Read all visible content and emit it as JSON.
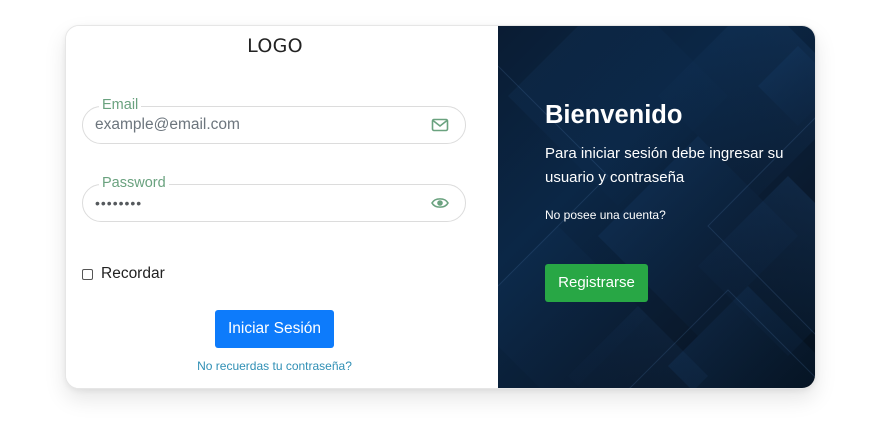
{
  "logo": {
    "text": "LOGO"
  },
  "login_form": {
    "email": {
      "label": "Email",
      "placeholder": "example@email.com",
      "icon": "envelope-icon"
    },
    "password": {
      "label": "Password",
      "value": "••••••••",
      "icon": "eye-icon"
    },
    "remember_label": "Recordar",
    "remember_checked": false,
    "submit_label": "Iniciar Sesión",
    "forgot_link": "No recuerdas tu contraseña?"
  },
  "welcome_panel": {
    "title": "Bienvenido",
    "instructions": "Para iniciar sesión debe ingresar su usuario y contraseña",
    "no_account_text": "No posee una cuenta?",
    "register_label": "Registrarse"
  },
  "colors": {
    "primary": "#0d7bfb",
    "success": "#28a745",
    "label_green": "#6aa27f",
    "link": "#2f8fb5",
    "panel_dark": "#0b2746"
  }
}
